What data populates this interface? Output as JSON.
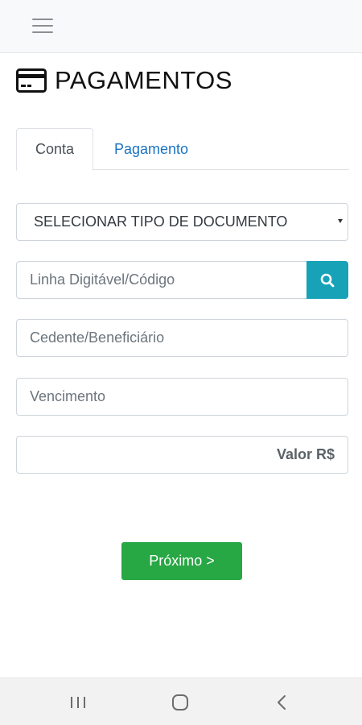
{
  "header": {
    "menu_icon": "hamburger-menu-icon"
  },
  "page": {
    "title_icon": "credit-card-icon",
    "title": "PAGAMENTOS"
  },
  "tabs": [
    {
      "label": "Conta",
      "active": true
    },
    {
      "label": "Pagamento",
      "active": false
    }
  ],
  "form": {
    "document_type": "SELECIONAR TIPO DE DOCUMENTO",
    "code_placeholder": "Linha Digitável/Código",
    "search_icon": "search-icon",
    "cedente_placeholder": "Cedente/Beneficiário",
    "vencimento_placeholder": "Vencimento",
    "valor_placeholder": "Valor R$"
  },
  "actions": {
    "next_label": "Próximo >"
  },
  "android_nav": {
    "recent_icon": "recent-apps-icon",
    "home_icon": "home-icon",
    "back_icon": "back-icon"
  },
  "colors": {
    "accent_search": "#17a2b8",
    "primary_button": "#28a745",
    "tab_link": "#1a73c4"
  }
}
